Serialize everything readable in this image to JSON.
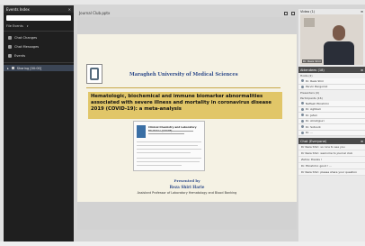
{
  "left_panel": {
    "title": "Events Index",
    "files_label": "File Events",
    "items": [
      {
        "icon": "document-icon",
        "label": "Chat Changes"
      },
      {
        "icon": "message-icon",
        "label": "Chat Messages"
      },
      {
        "icon": "people-icon",
        "label": "Events"
      }
    ],
    "sharing_label": "Sharing [00:00]"
  },
  "stage": {
    "title": "Journal Club.pptx"
  },
  "slide": {
    "university": "Maragheh University of Medical Sciences",
    "title": "Hematologic, biochemical and immune biomarker abnormalities associated with severe illness and mortality in coronavirus disease 2019 (COVID-19): a meta-analysis",
    "journal": "Clinical Chemistry and Laboratory Medicine (CCLM)",
    "presented_by": "Presented by",
    "presenter": "Reza Shiri Harie",
    "role": "Assistant Professor of Laboratory Hematology and Blood Banking"
  },
  "right_panel": {
    "video_label": "Video",
    "video_count": "(1)",
    "video_name": "Dr. Reza Shiri",
    "attendees_label": "Attendees",
    "attendees_count": "(18)",
    "hosts_label": "Hosts (2)",
    "hosts": [
      "Dr. Reza Shiri",
      "Parvin Bargomzi"
    ],
    "presenters_label": "Presenters (0)",
    "participants_label": "Participants (16)",
    "participants": [
      "Nafiseh Ebrahimi",
      "Dr. Aghbari",
      "Dr. Jafari",
      "Dr. Alirahjpuri",
      "Dr. Sotoodi",
      "Dr. ..."
    ],
    "chat_label": "Chat",
    "chat_scope": "(Everyone)",
    "chat_messages": [
      "Dr Reza Shiri: so nice to see you",
      "Dr Reza Shiri: welcome to journal club",
      "Zahra: thanks !",
      "Dr. Ebrahimi: good ! ...",
      "Dr Reza Shiri: please share your question"
    ]
  }
}
